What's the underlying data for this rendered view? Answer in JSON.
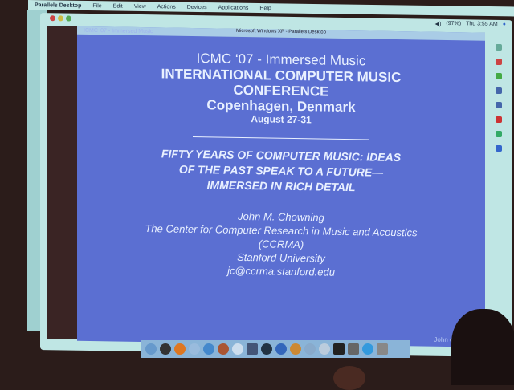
{
  "menubar": {
    "app": "Parallels Desktop",
    "items": [
      "File",
      "Edit",
      "View",
      "Actions",
      "Devices",
      "Applications",
      "Help"
    ]
  },
  "window": {
    "title": "Microsoft Windows XP - Parallels Desktop",
    "clock": "Thu 3:55 AM",
    "battery": "(97%)"
  },
  "slide": {
    "header": "ICMC '07 - Immersed Music",
    "line1": "ICMC ‘07 - Immersed Music",
    "line2": "INTERNATIONAL COMPUTER MUSIC",
    "line3": "CONFERENCE",
    "line4": "Copenhagen, Denmark",
    "date": "August 27-31",
    "t1": "FIFTY YEARS OF COMPUTER MUSIC: IDEAS",
    "t2": "OF THE PAST SPEAK TO A FUTURE—",
    "t3": "IMMERSED IN RICH DETAIL",
    "author": "John M. Chowning",
    "org": "The Center for Computer Research in Music and Acoustics",
    "abbr": "(CCRMA)",
    "uni": "Stanford University",
    "email": "jc@ccrma.stanford.edu",
    "footer": "John c"
  },
  "colors": {
    "slide": "#5b6fd2",
    "chrome": "#bfe6e4"
  }
}
